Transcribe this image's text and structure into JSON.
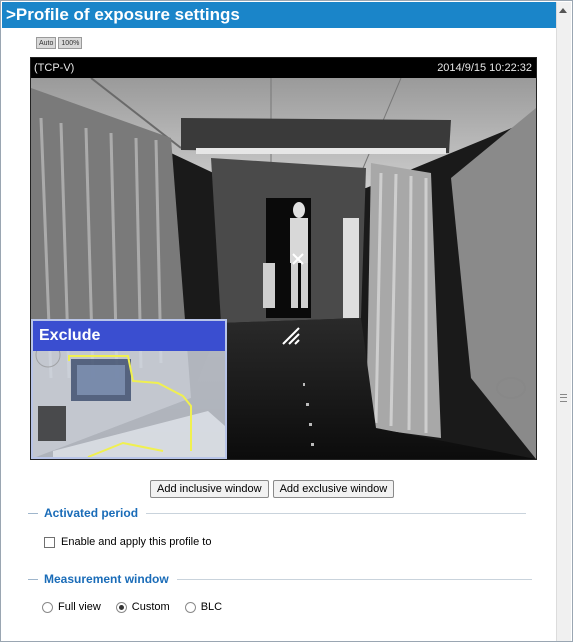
{
  "title": ">Profile of exposure settings",
  "zoom": {
    "auto_label": "Auto",
    "full_label": "100%"
  },
  "video": {
    "camera_label": "(TCP-V)",
    "timestamp": "2014/9/15 10:22:32"
  },
  "exclude_window": {
    "label": "Exclude"
  },
  "buttons": {
    "add_inclusive": "Add inclusive window",
    "add_exclusive": "Add exclusive window"
  },
  "activated_period": {
    "header": "Activated period",
    "checkbox_label": "Enable and apply this profile to",
    "checked": false
  },
  "measurement_window": {
    "header": "Measurement window",
    "options": [
      "Full view",
      "Custom",
      "BLC"
    ],
    "selected": "Custom"
  },
  "colors": {
    "title_bar": "#1a85c9",
    "section_header": "#1a6cb8",
    "exclude_bar": "#3a4ed0"
  }
}
